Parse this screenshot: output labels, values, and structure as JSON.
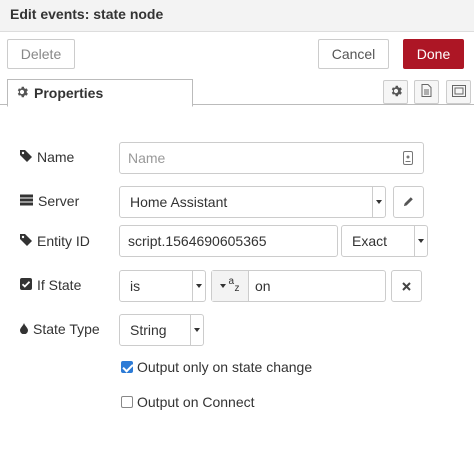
{
  "header": {
    "title": "Edit events: state node"
  },
  "toolbar": {
    "delete_label": "Delete",
    "cancel_label": "Cancel",
    "done_label": "Done"
  },
  "tabs": [
    {
      "label": "Properties"
    }
  ],
  "form": {
    "name": {
      "label": "Name",
      "placeholder": "Name"
    },
    "server": {
      "label": "Server",
      "value": "Home Assistant"
    },
    "entity_id": {
      "label": "Entity ID",
      "value": "script.1564690605365",
      "match": "Exact"
    },
    "if_state": {
      "label": "If State",
      "operator": "is",
      "type_glyph": "a",
      "type_glyph_sub": "z",
      "value": "on"
    },
    "state_type": {
      "label": "State Type",
      "value": "String"
    },
    "output_on_change": {
      "label": "Output only on state change",
      "checked": true
    },
    "output_on_connect": {
      "label": "Output on Connect",
      "checked": false
    }
  },
  "colors": {
    "accent": "#ad1625",
    "checkbox": "#2c7bd6"
  },
  "icons": [
    "gear-icon",
    "document-icon",
    "frame-icon",
    "tag-icon",
    "server-icon",
    "pencil-icon",
    "checkbox-icon",
    "tint-icon",
    "close-icon"
  ]
}
